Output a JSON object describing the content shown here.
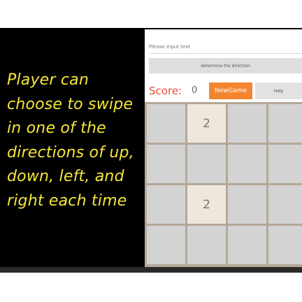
{
  "caption": {
    "lines": [
      "Player can",
      "choose to swipe",
      "in one of the",
      "directions of up,",
      "down, left, and",
      "right each time"
    ]
  },
  "app": {
    "input_placeholder": "Please input text",
    "determine_label": "determine the direction",
    "score_label": "Score:",
    "score_value": "0",
    "newgame_label": "NewGame",
    "help_label": "Help"
  },
  "board": {
    "cells": [
      [
        "",
        "2",
        "",
        ""
      ],
      [
        "",
        "",
        "",
        ""
      ],
      [
        "",
        "2",
        "",
        ""
      ],
      [
        "",
        "",
        "",
        ""
      ]
    ]
  },
  "colors": {
    "caption": "#f5e63a",
    "score_label": "#e8483b",
    "newgame_bg": "#f4852f",
    "tile_empty": "#d3d3d3",
    "tile_filled": "#efe6dc",
    "board_bg": "#b5a898"
  }
}
